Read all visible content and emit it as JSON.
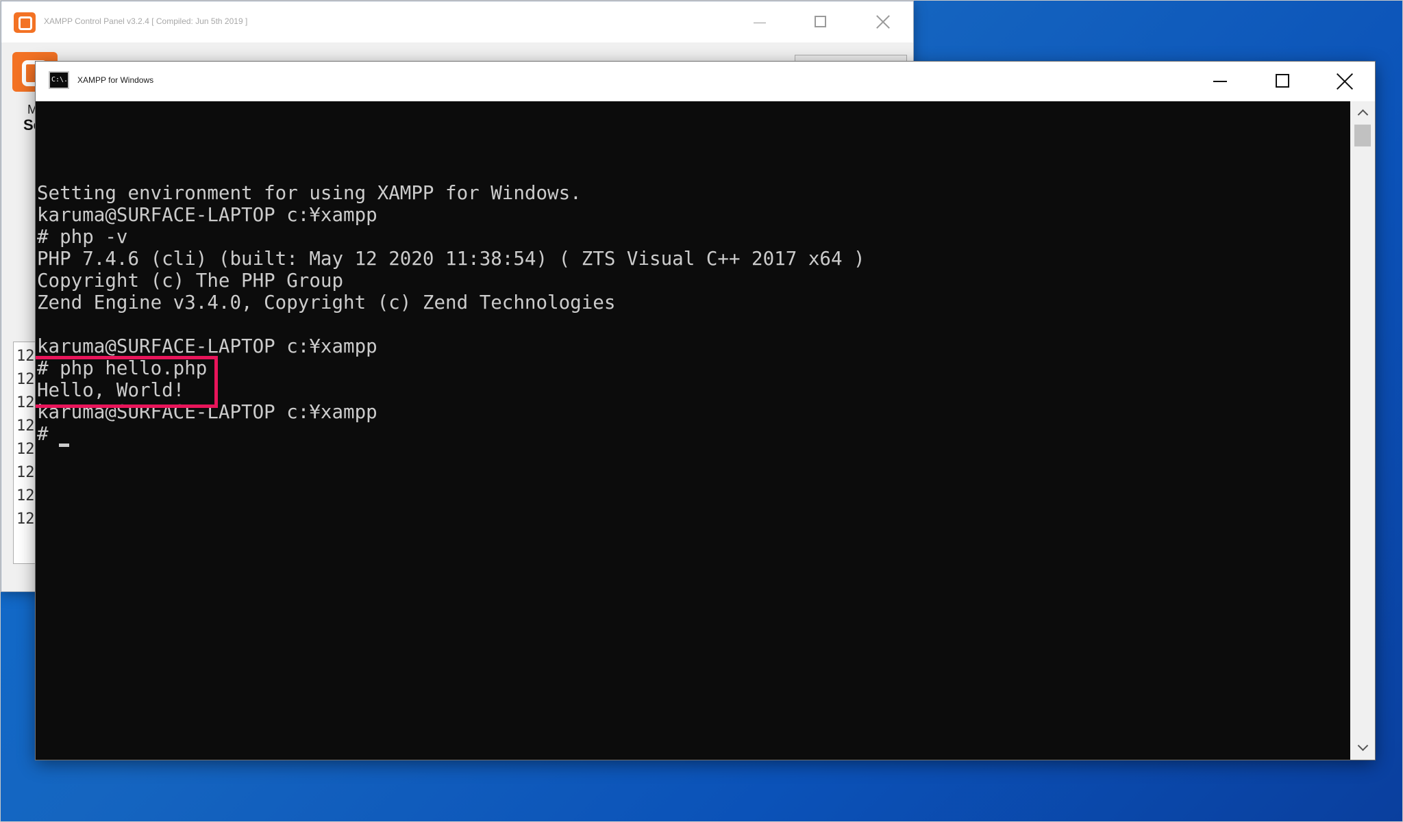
{
  "xampp_panel": {
    "title": "XAMPP Control Panel v3.2.4   [ Compiled: Jun 5th 2019 ]",
    "group_label": "M",
    "section_label": "Se",
    "log_rows": [
      "12",
      "12",
      "12",
      "12",
      "12",
      "12",
      "12",
      "12"
    ]
  },
  "console": {
    "window_title": "XAMPP for Windows",
    "icon_text": "C:\\.",
    "lines": [
      "Setting environment for using XAMPP for Windows.",
      "karuma@SURFACE-LAPTOP c:¥xampp",
      "# php -v",
      "PHP 7.4.6 (cli) (built: May 12 2020 11:38:54) ( ZTS Visual C++ 2017 x64 )",
      "Copyright (c) The PHP Group",
      "Zend Engine v3.4.0, Copyright (c) Zend Technologies",
      "",
      "karuma@SURFACE-LAPTOP c:¥xampp",
      "# php hello.php",
      "Hello, World!",
      "karuma@SURFACE-LAPTOP c:¥xampp",
      "# "
    ]
  },
  "colors": {
    "console_background": "#0c0c0c",
    "console_text": "#cccccc",
    "highlight_border": "#e8155a",
    "desktop_background": "#1565c0",
    "xampp_orange": "#f37224"
  },
  "icons": {
    "xampp_app": "xampp-logo-icon",
    "console_app": "cmd-icon",
    "minimize": "minimize-icon",
    "maximize": "maximize-icon",
    "close": "close-icon",
    "scroll_up": "chevron-up-icon",
    "scroll_down": "chevron-down-icon"
  }
}
